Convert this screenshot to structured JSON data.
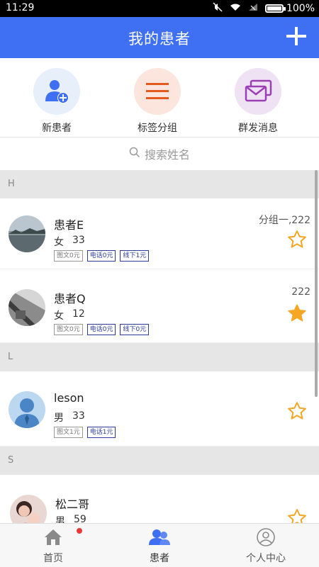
{
  "status_bar": {
    "time": "11:29",
    "battery": "100%"
  },
  "header": {
    "title": "我的患者"
  },
  "quick_actions": [
    {
      "label": "新患者",
      "icon": "add-user-icon",
      "bg": "#e6effa",
      "color": "#3f6ff2"
    },
    {
      "label": "标签分组",
      "icon": "list-icon",
      "bg": "#fbe5dc",
      "color": "#e25a1c"
    },
    {
      "label": "群发消息",
      "icon": "mail-icon",
      "bg": "#efe2f4",
      "color": "#9b3fb5"
    }
  ],
  "search": {
    "placeholder": "搜索姓名"
  },
  "sections": [
    {
      "letter": "H",
      "patients": [
        {
          "name": "患者E",
          "gender": "女",
          "age": "33",
          "group": "分组一,222",
          "starred": false,
          "tags": [
            "图文0元",
            "电话0元",
            "线下1元"
          ]
        },
        {
          "name": "患者Q",
          "gender": "女",
          "age": "12",
          "group": "222",
          "starred": true,
          "tags": [
            "图文0元",
            "电话0元",
            "线下0元"
          ]
        }
      ]
    },
    {
      "letter": "L",
      "patients": [
        {
          "name": "leson",
          "gender": "男",
          "age": "33",
          "group": "",
          "starred": false,
          "tags": [
            "图文1元",
            "电话1元"
          ]
        }
      ]
    },
    {
      "letter": "S",
      "patients": [
        {
          "name": "松二哥",
          "gender": "男",
          "age": "59",
          "group": "",
          "starred": false,
          "tags": []
        }
      ]
    }
  ],
  "bottom_nav": [
    {
      "label": "首页",
      "icon": "home-icon",
      "badge": true
    },
    {
      "label": "患者",
      "icon": "patients-icon",
      "active": true
    },
    {
      "label": "个人中心",
      "icon": "profile-icon"
    }
  ],
  "colors": {
    "header": "#3f6ff2",
    "star": "#f5a623",
    "tag_blue": "#2f3b9b"
  }
}
